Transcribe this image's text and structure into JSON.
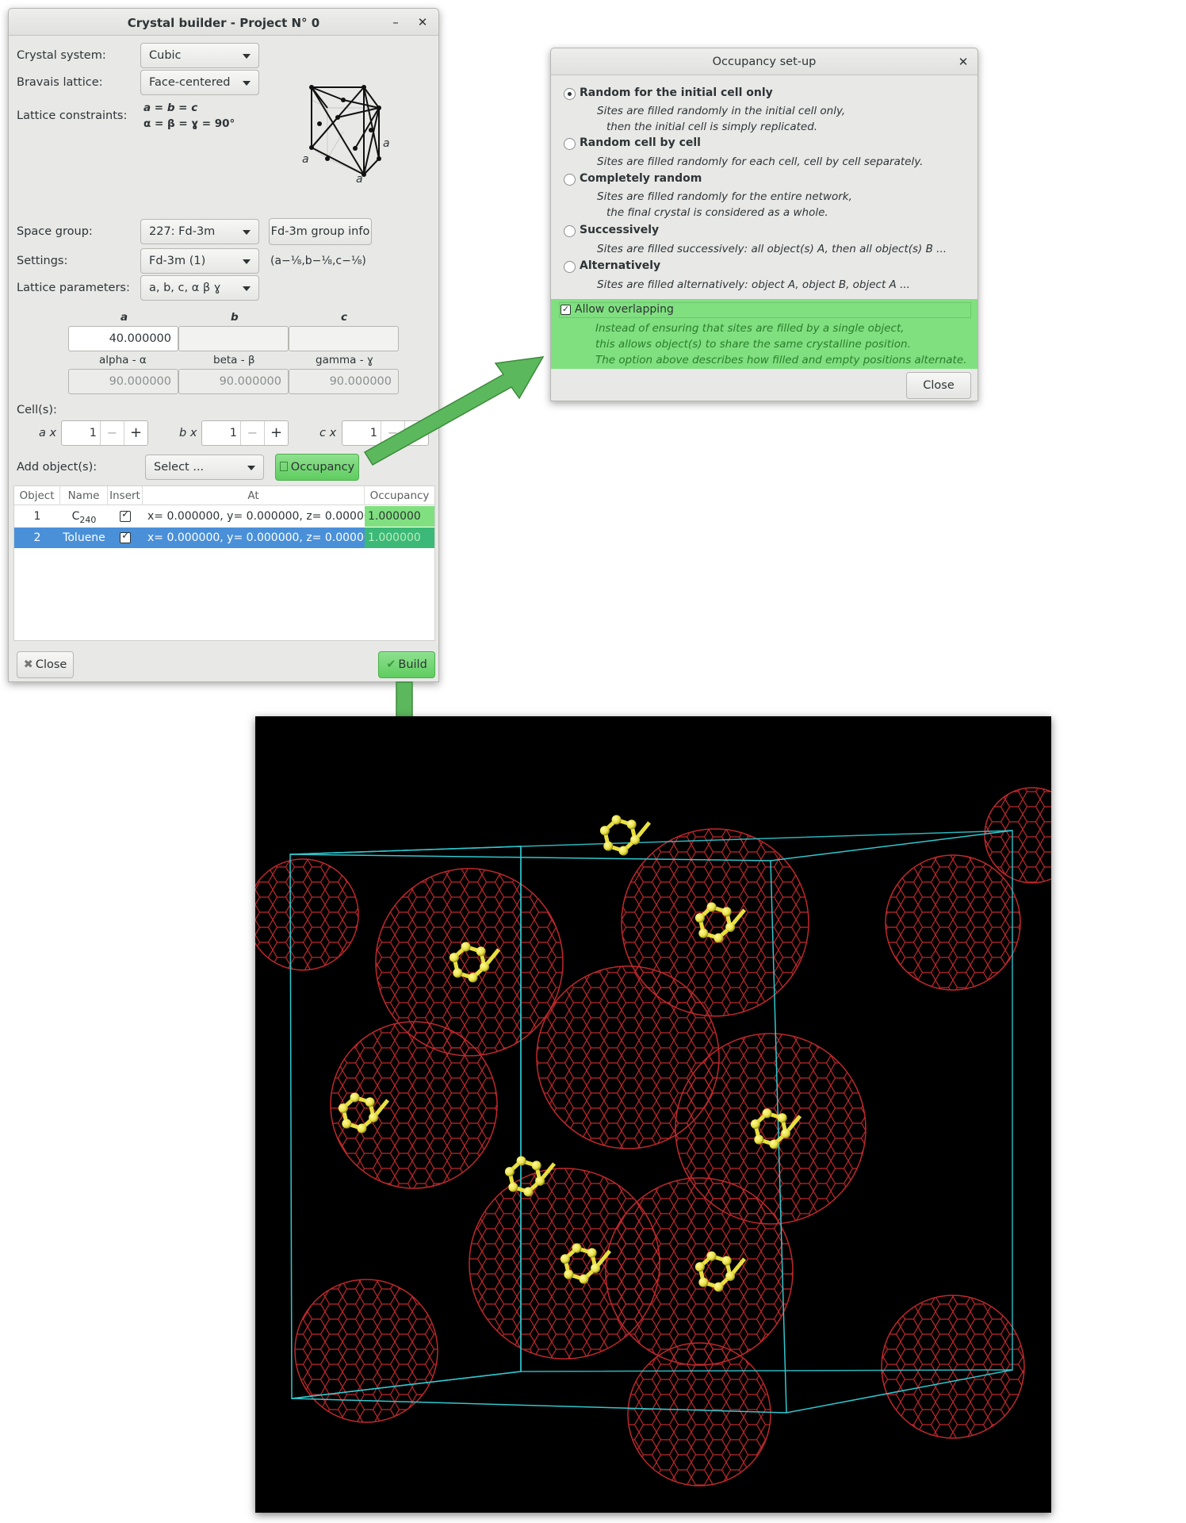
{
  "crystal_builder": {
    "title": "Crystal builder - Project N° 0",
    "minimize_icon": "minimize-icon",
    "close_icon": "close-icon",
    "crystal_system_label": "Crystal system:",
    "crystal_system_value": "Cubic",
    "bravais_label": "Bravais lattice:",
    "bravais_value": "Face-centered",
    "constraints_label": "Lattice constraints:",
    "constraint_1": "a = b = c",
    "constraint_2": "α = β = ɣ = 90°",
    "lattice_axis_labels": [
      "a",
      "a",
      "a"
    ],
    "space_group_label": "Space group:",
    "space_group_value": "227: Fd-3m",
    "group_info_button": "Fd-3m group info",
    "settings_label": "Settings:",
    "settings_value": "Fd-3m (1)",
    "settings_note": "(a−⅛,b−⅛,c−⅛)",
    "lattice_params_label": "Lattice parameters:",
    "lattice_params_value": "a, b, c, α β ɣ",
    "param_a_label": "a",
    "param_b_label": "b",
    "param_c_label": "c",
    "param_a_value": "40.000000",
    "param_b_value": "",
    "param_c_value": "",
    "alpha_label": "alpha - α",
    "beta_label": "beta - β",
    "gamma_label": "gamma - ɣ",
    "alpha_value": "90.000000",
    "beta_value": "90.000000",
    "gamma_value": "90.000000",
    "cells_label": "Cell(s):",
    "cell_a_label": "a x",
    "cell_b_label": "b x",
    "cell_c_label": "c x",
    "cell_a_value": "1",
    "cell_b_value": "1",
    "cell_c_value": "1",
    "spin_minus": "−",
    "spin_plus": "+",
    "add_objects_label": "Add object(s):",
    "add_objects_value": "Select ...",
    "occupancy_button": "Occupancy",
    "table": {
      "headers": [
        "Object",
        "Name",
        "Insert",
        "At",
        "Occupancy"
      ],
      "rows": [
        {
          "object": "1",
          "name": "C",
          "name_sub": "240",
          "insert": true,
          "at": "x= 0.000000, y= 0.000000, z= 0.000000",
          "occupancy": "1.000000"
        },
        {
          "object": "2",
          "name": "Toluene",
          "name_sub": "",
          "insert": true,
          "at": "x= 0.000000, y= 0.000000, z= 0.000000",
          "occupancy": "1.000000"
        }
      ]
    },
    "close_button": "Close",
    "build_button": "Build"
  },
  "occupancy_dialog": {
    "title": "Occupancy set-up",
    "options": [
      {
        "title": "Random for the initial cell only",
        "selected": true,
        "desc_1": "Sites are filled randomly in the initial cell only,",
        "desc_2": "then the initial cell is simply replicated."
      },
      {
        "title": "Random cell by cell",
        "selected": false,
        "desc_1": "Sites are filled randomly for each cell, cell by cell separately.",
        "desc_2": ""
      },
      {
        "title": "Completely random",
        "selected": false,
        "desc_1": "Sites are filled randomly for the entire network,",
        "desc_2": "the final crystal is considered as a whole."
      },
      {
        "title": "Successively",
        "selected": false,
        "desc_1": "Sites are filled successively: all object(s) A, then all object(s) B ...",
        "desc_2": ""
      },
      {
        "title": "Alternatively",
        "selected": false,
        "desc_1": "Sites are filled alternatively: object A, object B, object A ...",
        "desc_2": ""
      }
    ],
    "overlap_label": "Allow overlapping",
    "overlap_checked": true,
    "overlap_desc_1": "Instead of ensuring that sites are filled by a single object,",
    "overlap_desc_2": "this allows object(s) to share the same crystalline position.",
    "overlap_desc_3": "The option above describes how filled and empty positions alternate.",
    "close_button": "Close"
  },
  "colors": {
    "highlight_green": "#80e080",
    "selection_blue": "#4a90d9",
    "arrow_green": "#5cb85c",
    "cell_edges": "#30c8d0",
    "fullerene": "#c0282c",
    "toluene": "#e8e040"
  }
}
